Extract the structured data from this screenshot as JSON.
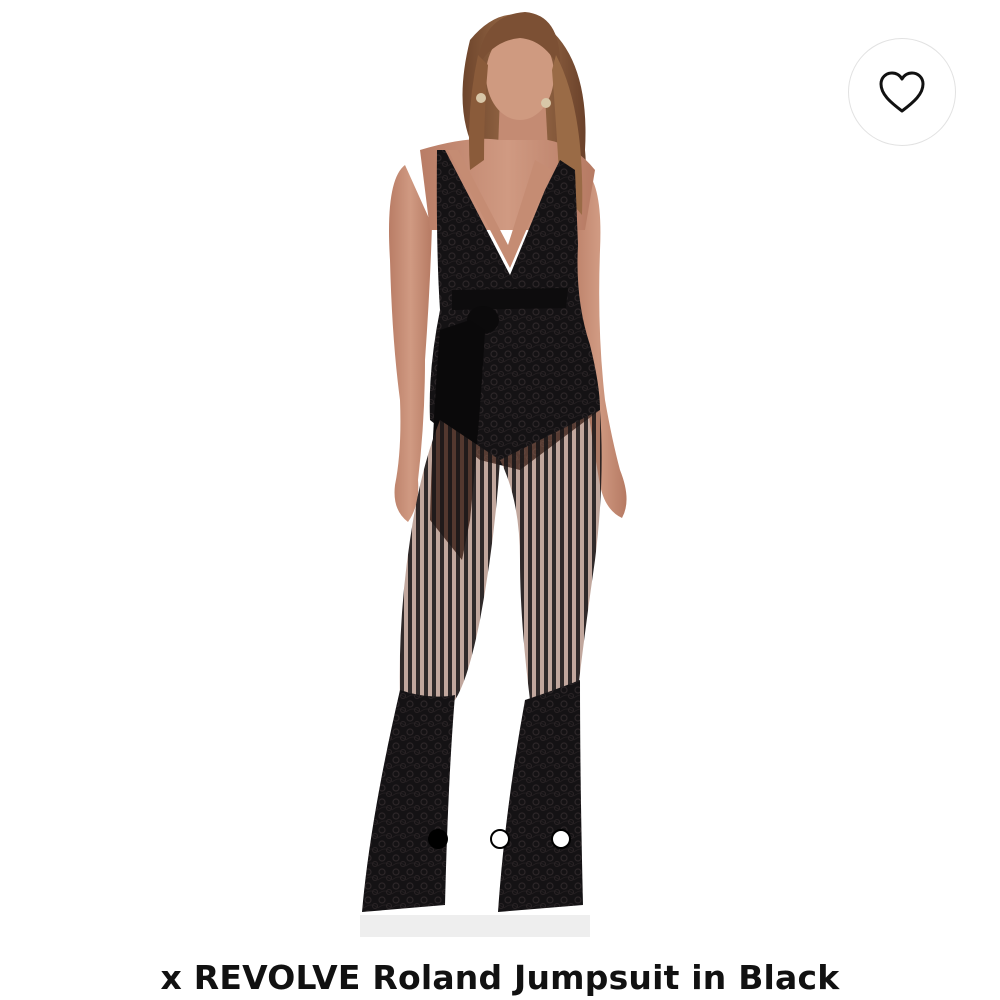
{
  "product": {
    "title": "x REVOLVE Roland Jumpsuit in Black",
    "image_subject": "model wearing black lace plunge jumpsuit with satin waist tie and flared lace-trim legs"
  },
  "wishlist": {
    "icon": "heart-outline-icon"
  },
  "carousel": {
    "total": 3,
    "active_index": 0,
    "dots": [
      {
        "state": "active"
      },
      {
        "state": "inactive"
      },
      {
        "state": "inactive"
      }
    ]
  },
  "colors": {
    "background": "#ffffff",
    "garment": "#121112",
    "skin": "#c9927a",
    "hair": "#8a5a3a",
    "accent": "#000000"
  }
}
